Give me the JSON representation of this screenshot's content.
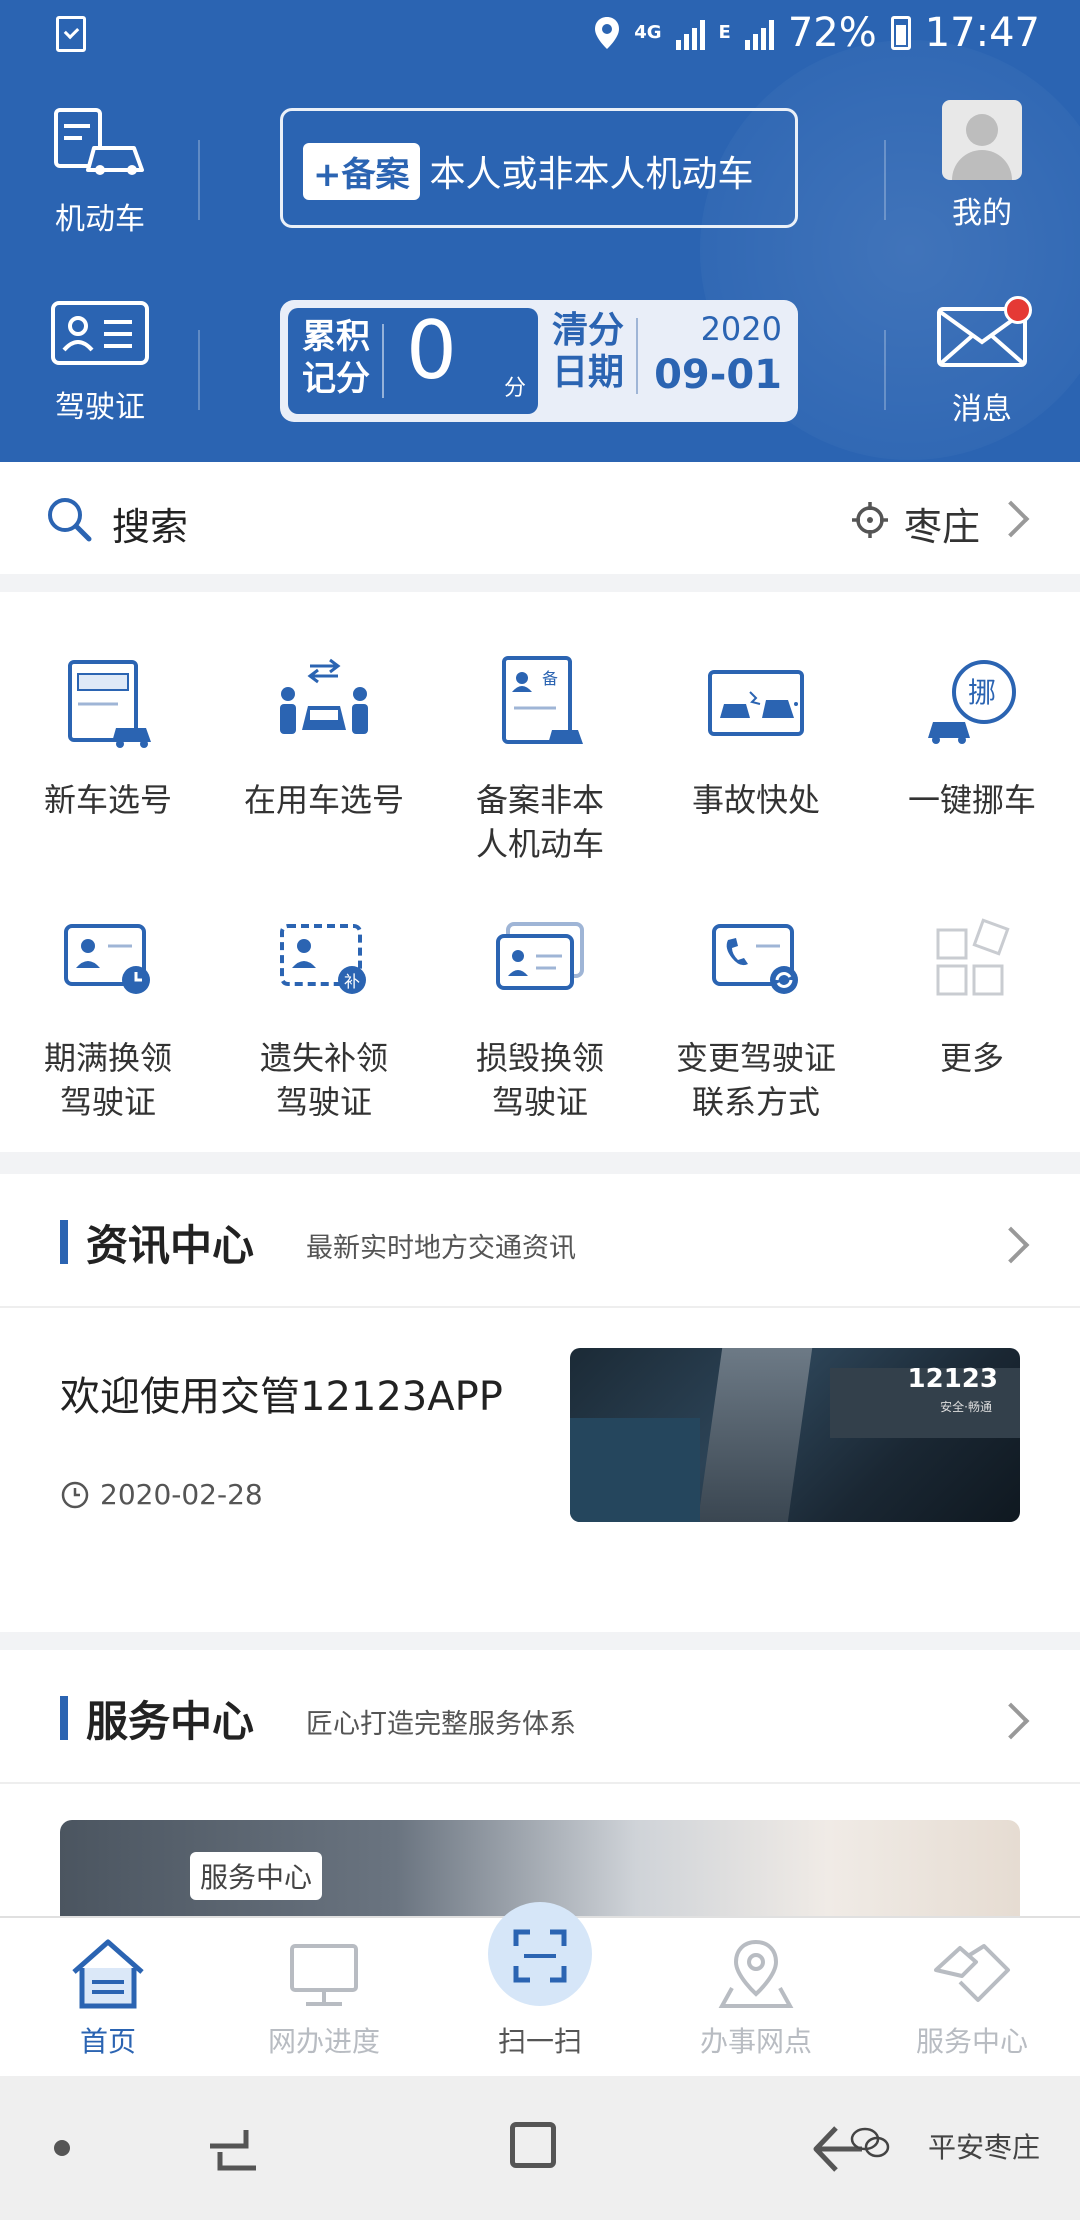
{
  "status_bar": {
    "battery": "72%",
    "time": "17:47",
    "network": "4G",
    "network2": "E"
  },
  "header": {
    "vehicle_label": "机动车",
    "license_label": "驾驶证",
    "register": {
      "tag": "+备案",
      "text": "本人或非本人机动车"
    },
    "score": {
      "accum_label_1": "累积",
      "accum_label_2": "记分",
      "points": "0",
      "unit": "分",
      "clear_label_1": "清分",
      "clear_label_2": "日期",
      "year": "2020",
      "date": "09-01"
    },
    "mine_label": "我的",
    "message_label": "消息"
  },
  "search": {
    "label": "搜索",
    "city": "枣庄"
  },
  "services": [
    {
      "label": "新车选号",
      "icon": "new-car-plate-icon"
    },
    {
      "label": "在用车选号",
      "icon": "used-car-plate-icon"
    },
    {
      "label": "备案非本\n人机动车",
      "icon": "register-vehicle-icon"
    },
    {
      "label": "事故快处",
      "icon": "accident-icon"
    },
    {
      "label": "一键挪车",
      "icon": "move-car-icon"
    },
    {
      "label": "期满换领\n驾驶证",
      "icon": "license-renew-icon"
    },
    {
      "label": "遗失补领\n驾驶证",
      "icon": "license-replace-icon"
    },
    {
      "label": "损毁换领\n驾驶证",
      "icon": "license-damaged-icon"
    },
    {
      "label": "变更驾驶证\n联系方式",
      "icon": "license-contact-icon"
    },
    {
      "label": "更多",
      "icon": "more-icon"
    }
  ],
  "news_section": {
    "title": "资讯中心",
    "subtitle": "最新实时地方交通资讯",
    "item": {
      "title": "欢迎使用交管12123APP",
      "date": "2020-02-28",
      "image_text": "12123",
      "image_subtext": "安全·畅通"
    }
  },
  "service_section": {
    "title": "服务中心",
    "subtitle": "匠心打造完整服务体系",
    "banner_tag": "服务中心"
  },
  "bottom_nav": [
    {
      "label": "首页",
      "icon": "home-icon",
      "active": true
    },
    {
      "label": "网办进度",
      "icon": "monitor-icon",
      "active": false
    },
    {
      "label": "扫一扫",
      "icon": "scan-icon",
      "active": false
    },
    {
      "label": "办事网点",
      "icon": "map-pin-icon",
      "active": false
    },
    {
      "label": "服务中心",
      "icon": "handshake-icon",
      "active": false
    }
  ],
  "watermark": "平安枣庄",
  "colors": {
    "primary": "#2b64b2",
    "accent_red": "#e53935",
    "inactive": "#b8bcc2"
  }
}
